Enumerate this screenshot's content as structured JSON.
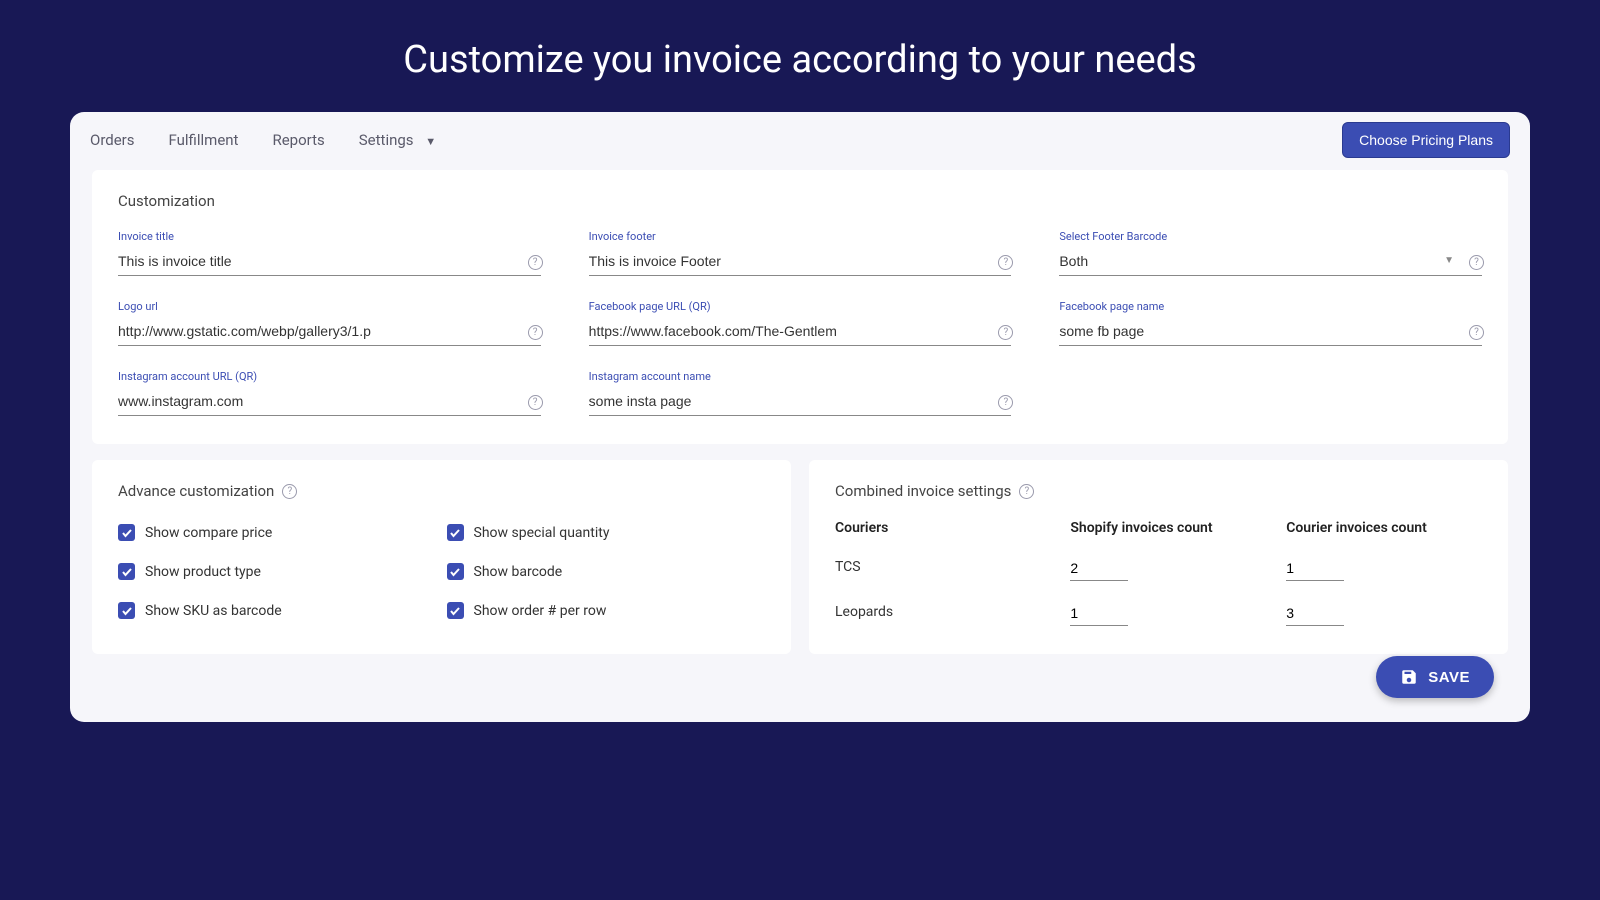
{
  "page_title": "Customize you invoice according to your needs",
  "nav": {
    "items": [
      "Orders",
      "Fulfillment",
      "Reports",
      "Settings"
    ],
    "pricing_btn": "Choose Pricing Plans"
  },
  "cust": {
    "title": "Customization",
    "fields": {
      "invoice_title": {
        "label": "Invoice title",
        "value": "This is invoice title"
      },
      "invoice_footer": {
        "label": "Invoice footer",
        "value": "This is invoice Footer"
      },
      "footer_barcode": {
        "label": "Select Footer Barcode",
        "value": "Both"
      },
      "logo_url": {
        "label": "Logo url",
        "value": "http://www.gstatic.com/webp/gallery3/1.p"
      },
      "fb_url": {
        "label": "Facebook page URL (QR)",
        "value": "https://www.facebook.com/The-Gentlem"
      },
      "fb_name": {
        "label": "Facebook page name",
        "value": "some fb page"
      },
      "ig_url": {
        "label": "Instagram account URL (QR)",
        "value": "www.instagram.com"
      },
      "ig_name": {
        "label": "Instagram account name",
        "value": "some insta page"
      }
    }
  },
  "adv": {
    "title": "Advance customization",
    "checks": [
      {
        "label": "Show compare price",
        "checked": true
      },
      {
        "label": "Show special quantity",
        "checked": true
      },
      {
        "label": "Show product type",
        "checked": true
      },
      {
        "label": "Show barcode",
        "checked": true
      },
      {
        "label": "Show SKU as barcode",
        "checked": true
      },
      {
        "label": "Show order # per row",
        "checked": true
      }
    ]
  },
  "comb": {
    "title": "Combined invoice settings",
    "headers": [
      "Couriers",
      "Shopify invoices count",
      "Courier invoices count"
    ],
    "rows": [
      {
        "courier": "TCS",
        "shopify": "2",
        "courier_count": "1"
      },
      {
        "courier": "Leopards",
        "shopify": "1",
        "courier_count": "3"
      }
    ]
  },
  "save_label": "SAVE"
}
